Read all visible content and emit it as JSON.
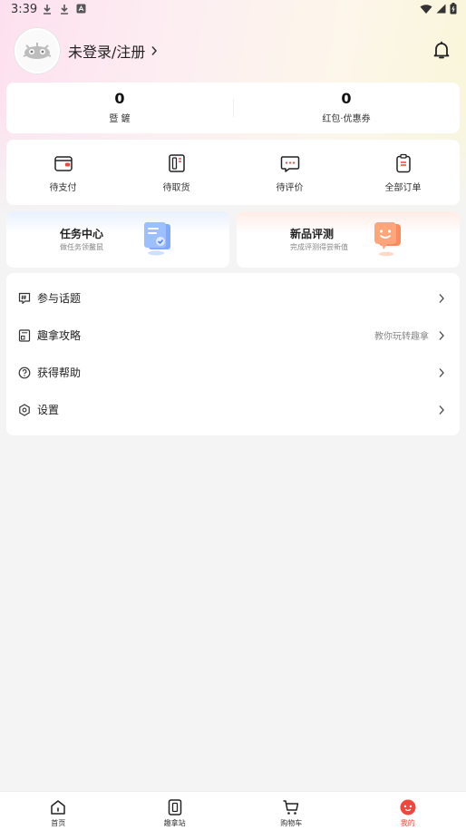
{
  "status_bar": {
    "time": "3:39"
  },
  "profile": {
    "login_label": "未登录/注册"
  },
  "stats": [
    {
      "value": "0",
      "label": "暨 鏟"
    },
    {
      "value": "0",
      "label": "红包·优惠券"
    }
  ],
  "orders": [
    {
      "label": "待支付",
      "icon": "wallet-icon"
    },
    {
      "label": "待取货",
      "icon": "locker-icon"
    },
    {
      "label": "待评价",
      "icon": "comment-icon"
    },
    {
      "label": "全部订单",
      "icon": "clipboard-icon"
    }
  ],
  "promos": [
    {
      "title": "任务中心",
      "subtitle": "做任务领鳌鼠",
      "icon": "task-3d-icon"
    },
    {
      "title": "新品评测",
      "subtitle": "完成评测得尝新值",
      "icon": "smile-3d-icon"
    }
  ],
  "menu": [
    {
      "label": "参与话题",
      "hint": "",
      "icon": "topic-icon"
    },
    {
      "label": "趣拿攻略",
      "hint": "教你玩转趣拿",
      "icon": "guide-icon"
    },
    {
      "label": "获得帮助",
      "hint": "",
      "icon": "help-icon"
    },
    {
      "label": "设置",
      "hint": "",
      "icon": "settings-icon"
    }
  ],
  "tabs": [
    {
      "label": "首页",
      "icon": "home-icon"
    },
    {
      "label": "趣拿站",
      "icon": "station-icon"
    },
    {
      "label": "购物车",
      "icon": "cart-icon"
    },
    {
      "label": "我的",
      "icon": "profile-face-icon",
      "active": true
    }
  ],
  "colors": {
    "accent": "#f0463c",
    "background": "#f4f4f4",
    "card": "#ffffff"
  }
}
